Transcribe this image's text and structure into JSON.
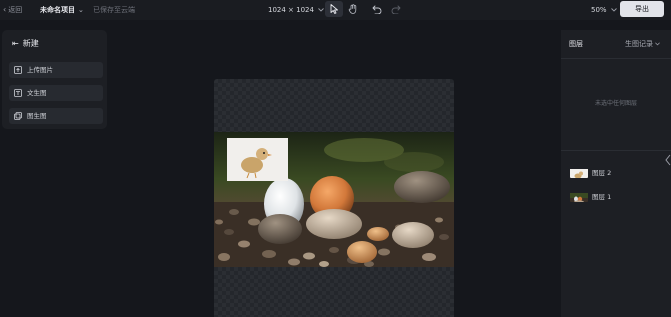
{
  "topbar": {
    "back_label": "返回",
    "project_name": "未命名项目",
    "save_status": "已保存至云端",
    "canvas_size": "1024 × 1024",
    "zoom": "50%",
    "export_label": "导出"
  },
  "left_panel": {
    "title": "新建",
    "items": [
      {
        "label": "上传图片",
        "icon": "upload-image-icon"
      },
      {
        "label": "文生图",
        "icon": "text-to-image-icon"
      },
      {
        "label": "图生图",
        "icon": "image-to-image-icon"
      }
    ]
  },
  "right_panel": {
    "tabs": [
      "图层",
      "生图记录"
    ],
    "empty_hint": "未选中任何图层",
    "layers": [
      {
        "name": "图层 2"
      },
      {
        "name": "图层 1"
      }
    ]
  },
  "colors": {
    "background": "#15171c",
    "panel": "#1d1f24",
    "export_button": "#e2e4ea"
  }
}
